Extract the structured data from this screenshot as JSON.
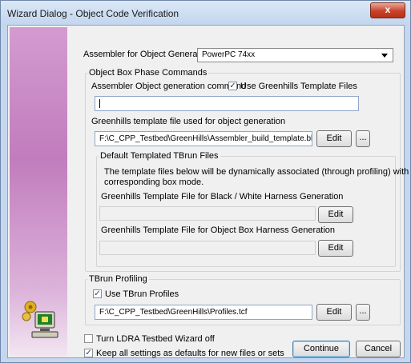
{
  "window": {
    "title": "Wizard Dialog - Object Code Verification",
    "close_glyph": "x"
  },
  "assembler": {
    "label": "Assembler for Object Generation",
    "selected": "PowerPC 74xx"
  },
  "object_box": {
    "title": "Object Box Phase Commands",
    "cmd_label": "Assembler Object generation command",
    "use_template_label": "Use Greenhills Template Files",
    "use_template_checked": true,
    "cmd_value": "",
    "template_label": "Greenhills template file used for object generation",
    "template_value": "F:\\C_CPP_Testbed\\GreenHills\\Assembler_build_template.bld",
    "edit": "Edit",
    "browse": "..."
  },
  "default_templated": {
    "title": "Default Templated TBrun Files",
    "description_line1": "The template files below will be dynamically associated (through profiling) with their",
    "description_line2": "corresponding box mode.",
    "bw_label": "Greenhills Template File for Black / White Harness Generation",
    "bw_value": "",
    "ob_label": "Greenhills Template File for Object Box Harness Generation",
    "ob_value": "",
    "edit": "Edit"
  },
  "tbrun": {
    "title": "TBrun Profiling",
    "use_profiles_label": "Use TBrun Profiles",
    "use_profiles_checked": true,
    "profile_value": "F:\\C_CPP_Testbed\\GreenHills\\Profiles.tcf",
    "edit": "Edit",
    "browse": "..."
  },
  "footer": {
    "wizard_off_label": "Turn LDRA Testbed Wizard off",
    "wizard_off_checked": false,
    "keep_label": "Keep all settings as defaults for new files or sets",
    "keep_checked": true,
    "continue": "Continue",
    "cancel": "Cancel"
  },
  "icons": {
    "sidebar_logo": "computer-with-gears-icon",
    "checkmark": "✓"
  },
  "colors": {
    "sidebar": "#c17cbd",
    "close_button": "#c9412a"
  }
}
